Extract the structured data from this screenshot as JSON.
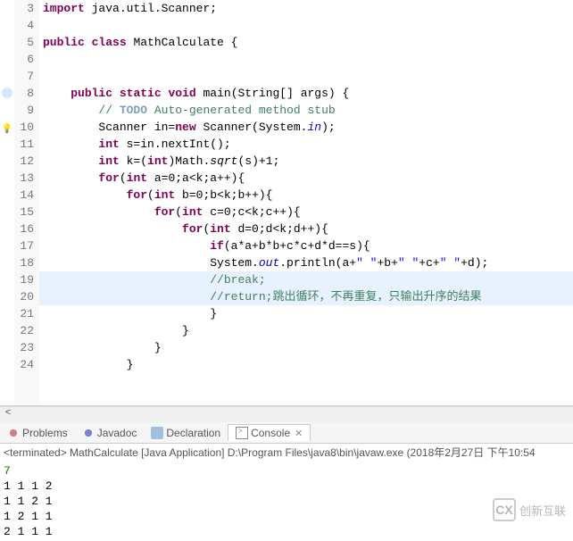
{
  "editor": {
    "first_line": 3,
    "highlight_lines": [
      19,
      20
    ],
    "lines": [
      {
        "n": 3,
        "mk": "",
        "seg": [
          [
            "kw",
            "import"
          ],
          [
            "",
            " java.util.Scanner;"
          ]
        ]
      },
      {
        "n": 4,
        "mk": "",
        "seg": [
          [
            "",
            ""
          ]
        ]
      },
      {
        "n": 5,
        "mk": "",
        "seg": [
          [
            "kw",
            "public"
          ],
          [
            "",
            " "
          ],
          [
            "kw",
            "class"
          ],
          [
            "",
            " MathCalculate {"
          ]
        ]
      },
      {
        "n": 6,
        "mk": "",
        "seg": [
          [
            "",
            ""
          ]
        ]
      },
      {
        "n": 7,
        "mk": "",
        "seg": [
          [
            "",
            ""
          ]
        ]
      },
      {
        "n": 8,
        "mk": "blue",
        "seg": [
          [
            "",
            "    "
          ],
          [
            "kw",
            "public"
          ],
          [
            "",
            " "
          ],
          [
            "kw",
            "static"
          ],
          [
            "",
            " "
          ],
          [
            "kw",
            "void"
          ],
          [
            "",
            " main(String[] args) {"
          ]
        ]
      },
      {
        "n": 9,
        "mk": "",
        "seg": [
          [
            "",
            "        "
          ],
          [
            "cm",
            "// "
          ],
          [
            "cm-tag",
            "TODO"
          ],
          [
            "cm",
            " Auto-generated method stub"
          ]
        ]
      },
      {
        "n": 10,
        "mk": "bulb",
        "seg": [
          [
            "",
            "        Scanner in="
          ],
          [
            "kw",
            "new"
          ],
          [
            "",
            " Scanner(System."
          ],
          [
            "fld",
            "in"
          ],
          [
            "",
            ");"
          ]
        ]
      },
      {
        "n": 11,
        "mk": "",
        "seg": [
          [
            "",
            "        "
          ],
          [
            "kw",
            "int"
          ],
          [
            "",
            " s=in.nextInt();"
          ]
        ]
      },
      {
        "n": 12,
        "mk": "",
        "seg": [
          [
            "",
            "        "
          ],
          [
            "kw",
            "int"
          ],
          [
            "",
            " k=("
          ],
          [
            "kw",
            "int"
          ],
          [
            "",
            ")Math."
          ],
          [
            "",
            "sqrt"
          ],
          [
            "",
            "(s)+1;"
          ]
        ],
        "italic": "sqrt"
      },
      {
        "n": 13,
        "mk": "",
        "seg": [
          [
            "",
            "        "
          ],
          [
            "kw",
            "for"
          ],
          [
            "",
            "("
          ],
          [
            "kw",
            "int"
          ],
          [
            "",
            " a=0;a<k;a++){"
          ]
        ]
      },
      {
        "n": 14,
        "mk": "",
        "seg": [
          [
            "",
            "            "
          ],
          [
            "kw",
            "for"
          ],
          [
            "",
            "("
          ],
          [
            "kw",
            "int"
          ],
          [
            "",
            " b=0;b<k;b++){"
          ]
        ]
      },
      {
        "n": 15,
        "mk": "",
        "seg": [
          [
            "",
            "                "
          ],
          [
            "kw",
            "for"
          ],
          [
            "",
            "("
          ],
          [
            "kw",
            "int"
          ],
          [
            "",
            " c=0;c<k;c++){"
          ]
        ]
      },
      {
        "n": 16,
        "mk": "",
        "seg": [
          [
            "",
            "                    "
          ],
          [
            "kw",
            "for"
          ],
          [
            "",
            "("
          ],
          [
            "kw",
            "int"
          ],
          [
            "",
            " d=0;d<k;d++){"
          ]
        ]
      },
      {
        "n": 17,
        "mk": "",
        "seg": [
          [
            "",
            "                        "
          ],
          [
            "kw",
            "if"
          ],
          [
            "",
            "(a*a+b*b+c*c+d*d==s){"
          ]
        ]
      },
      {
        "n": 18,
        "mk": "",
        "seg": [
          [
            "",
            "                        System."
          ],
          [
            "fld",
            "out"
          ],
          [
            "",
            ".println(a+"
          ],
          [
            "str",
            "\" \""
          ],
          [
            "",
            "+b+"
          ],
          [
            "str",
            "\" \""
          ],
          [
            "",
            "+c+"
          ],
          [
            "str",
            "\" \""
          ],
          [
            "",
            "+d);"
          ]
        ]
      },
      {
        "n": 19,
        "mk": "",
        "seg": [
          [
            "",
            "                        "
          ],
          [
            "cm",
            "//break;"
          ]
        ]
      },
      {
        "n": 20,
        "mk": "",
        "seg": [
          [
            "",
            "                        "
          ],
          [
            "cm",
            "//return;跳出循环，不再重复，只输出升序的结果"
          ]
        ]
      },
      {
        "n": 21,
        "mk": "",
        "seg": [
          [
            "",
            "                        }"
          ]
        ]
      },
      {
        "n": 22,
        "mk": "",
        "seg": [
          [
            "",
            "                    }"
          ]
        ]
      },
      {
        "n": 23,
        "mk": "",
        "seg": [
          [
            "",
            "                }"
          ]
        ]
      },
      {
        "n": 24,
        "mk": "",
        "seg": [
          [
            "",
            "            }"
          ]
        ]
      }
    ]
  },
  "tabs": [
    {
      "label": "Problems",
      "icon": "problems",
      "active": false
    },
    {
      "label": "Javadoc",
      "icon": "javadoc",
      "active": false
    },
    {
      "label": "Declaration",
      "icon": "decl",
      "active": false
    },
    {
      "label": "Console",
      "icon": "console",
      "active": true
    }
  ],
  "console": {
    "status": "<terminated> MathCalculate [Java Application] D:\\Program Files\\java8\\bin\\javaw.exe (2018年2月27日 下午10:54",
    "input": "7",
    "lines": [
      "1 1 1 2",
      "1 1 2 1",
      "1 2 1 1",
      "2 1 1 1"
    ]
  },
  "watermark": {
    "logo": "CX",
    "text": "创新互联"
  }
}
